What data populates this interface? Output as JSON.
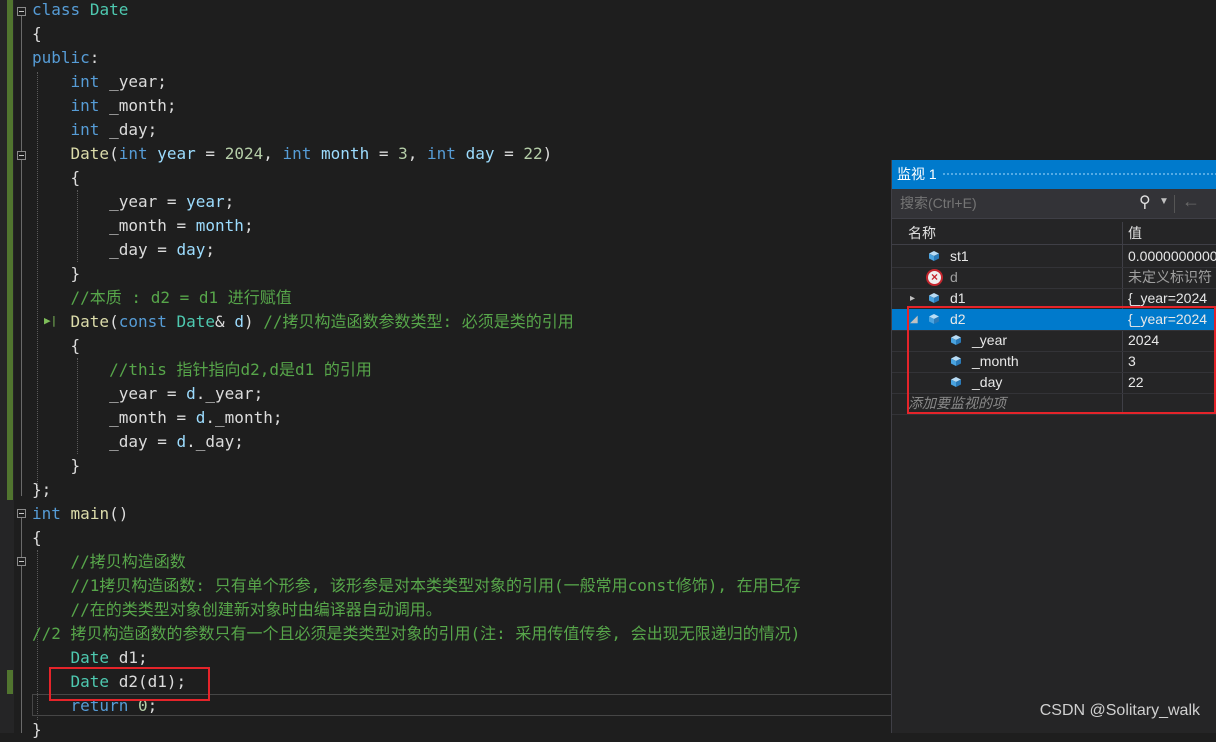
{
  "editor": {
    "lines": [
      {
        "parts": [
          [
            "kw",
            "class"
          ],
          [
            "pl",
            " "
          ],
          [
            "ty",
            "Date"
          ]
        ]
      },
      {
        "parts": [
          [
            "pl",
            "{"
          ]
        ]
      },
      {
        "parts": [
          [
            "kw",
            "public"
          ],
          [
            "pl",
            ":"
          ]
        ]
      },
      {
        "parts": [
          [
            "pl",
            "    "
          ],
          [
            "kw",
            "int"
          ],
          [
            "pl",
            " _year;"
          ]
        ]
      },
      {
        "parts": [
          [
            "pl",
            "    "
          ],
          [
            "kw",
            "int"
          ],
          [
            "pl",
            " _month;"
          ]
        ]
      },
      {
        "parts": [
          [
            "pl",
            "    "
          ],
          [
            "kw",
            "int"
          ],
          [
            "pl",
            " _day;"
          ]
        ]
      },
      {
        "parts": [
          [
            "pl",
            "    "
          ],
          [
            "fn",
            "Date"
          ],
          [
            "pl",
            "("
          ],
          [
            "kw",
            "int"
          ],
          [
            "pl",
            " "
          ],
          [
            "va",
            "year"
          ],
          [
            "pl",
            " = "
          ],
          [
            "nu",
            "2024"
          ],
          [
            "pl",
            ", "
          ],
          [
            "kw",
            "int"
          ],
          [
            "pl",
            " "
          ],
          [
            "va",
            "month"
          ],
          [
            "pl",
            " = "
          ],
          [
            "nu",
            "3"
          ],
          [
            "pl",
            ", "
          ],
          [
            "kw",
            "int"
          ],
          [
            "pl",
            " "
          ],
          [
            "va",
            "day"
          ],
          [
            "pl",
            " = "
          ],
          [
            "nu",
            "22"
          ],
          [
            "pl",
            ")"
          ]
        ]
      },
      {
        "parts": [
          [
            "pl",
            "    {"
          ]
        ]
      },
      {
        "parts": [
          [
            "pl",
            "        _year = "
          ],
          [
            "va",
            "year"
          ],
          [
            "pl",
            ";"
          ]
        ]
      },
      {
        "parts": [
          [
            "pl",
            "        _month = "
          ],
          [
            "va",
            "month"
          ],
          [
            "pl",
            ";"
          ]
        ]
      },
      {
        "parts": [
          [
            "pl",
            "        _day = "
          ],
          [
            "va",
            "day"
          ],
          [
            "pl",
            ";"
          ]
        ]
      },
      {
        "parts": [
          [
            "pl",
            "    }"
          ]
        ]
      },
      {
        "parts": [
          [
            "pl",
            "    "
          ],
          [
            "cm",
            "//本质 : d2 = d1 进行赋值"
          ]
        ]
      },
      {
        "parts": [
          [
            "pl",
            "    "
          ],
          [
            "fn",
            "Date"
          ],
          [
            "pl",
            "("
          ],
          [
            "kw",
            "const"
          ],
          [
            "pl",
            " "
          ],
          [
            "ty",
            "Date"
          ],
          [
            "pl",
            "& "
          ],
          [
            "va",
            "d"
          ],
          [
            "pl",
            ") "
          ],
          [
            "cm",
            "//拷贝构造函数参数类型: 必须是类的引用"
          ]
        ]
      },
      {
        "parts": [
          [
            "pl",
            "    {"
          ]
        ]
      },
      {
        "parts": [
          [
            "pl",
            "        "
          ],
          [
            "cm",
            "//this 指针指向d2,d是d1 的引用"
          ]
        ]
      },
      {
        "parts": [
          [
            "pl",
            "        _year = "
          ],
          [
            "va",
            "d"
          ],
          [
            "pl",
            "._year;"
          ]
        ]
      },
      {
        "parts": [
          [
            "pl",
            "        _month = "
          ],
          [
            "va",
            "d"
          ],
          [
            "pl",
            "._month;"
          ]
        ]
      },
      {
        "parts": [
          [
            "pl",
            "        _day = "
          ],
          [
            "va",
            "d"
          ],
          [
            "pl",
            "._day;"
          ]
        ]
      },
      {
        "parts": [
          [
            "pl",
            "    }"
          ]
        ]
      },
      {
        "parts": [
          [
            "pl",
            "};"
          ]
        ]
      },
      {
        "parts": [
          [
            "kw",
            "int"
          ],
          [
            "pl",
            " "
          ],
          [
            "fn",
            "main"
          ],
          [
            "pl",
            "()"
          ]
        ]
      },
      {
        "parts": [
          [
            "pl",
            "{"
          ]
        ]
      },
      {
        "parts": [
          [
            "pl",
            "    "
          ],
          [
            "cm",
            "//拷贝构造函数"
          ]
        ]
      },
      {
        "parts": [
          [
            "pl",
            "    "
          ],
          [
            "cm",
            "//1拷贝构造函数: 只有单个形参, 该形参是对本类类型对象的引用(一般常用const修饰), 在用已存"
          ]
        ]
      },
      {
        "parts": [
          [
            "pl",
            "    "
          ],
          [
            "cm",
            "//在的类类型对象创建新对象时由编译器自动调用。"
          ]
        ]
      },
      {
        "parts": [
          [
            "cm",
            "//2 拷贝构造函数的参数只有一个且必须是类类型对象的引用(注: 采用传值传参, 会出现无限递归的情况)"
          ]
        ]
      },
      {
        "parts": [
          [
            "pl",
            "    "
          ],
          [
            "ty",
            "Date"
          ],
          [
            "pl",
            " d1;"
          ]
        ]
      },
      {
        "parts": [
          [
            "pl",
            "    "
          ],
          [
            "ty",
            "Date"
          ],
          [
            "pl",
            " d2(d1);"
          ]
        ]
      },
      {
        "parts": [
          [
            "pl",
            "    "
          ],
          [
            "kw",
            "return"
          ],
          [
            "pl",
            " "
          ],
          [
            "nu",
            "0"
          ],
          [
            "pl",
            ";"
          ]
        ]
      },
      {
        "parts": [
          [
            "pl",
            "}"
          ]
        ]
      }
    ]
  },
  "watch": {
    "title": "监视 1",
    "search_placeholder": "搜索(Ctrl+E)",
    "col_name": "名称",
    "col_value": "值",
    "rows": [
      {
        "name": "st1",
        "value": "0.000000000000",
        "kind": "obj",
        "depth": 0,
        "expand": ""
      },
      {
        "name": "d",
        "value": "未定义标识符",
        "kind": "err",
        "depth": 0,
        "expand": ""
      },
      {
        "name": "d1",
        "value": "{_year=2024",
        "kind": "obj",
        "depth": 0,
        "expand": "▸"
      },
      {
        "name": "d2",
        "value": "{_year=2024",
        "kind": "obj",
        "depth": 0,
        "expand": "◢",
        "selected": true
      },
      {
        "name": "_year",
        "value": "2024",
        "kind": "field",
        "depth": 1,
        "expand": ""
      },
      {
        "name": "_month",
        "value": "3",
        "kind": "field",
        "depth": 1,
        "expand": ""
      },
      {
        "name": "_day",
        "value": "22",
        "kind": "field",
        "depth": 1,
        "expand": ""
      }
    ],
    "add_item": "添加要监视的项"
  },
  "watermark": "CSDN @Solitary_walk"
}
